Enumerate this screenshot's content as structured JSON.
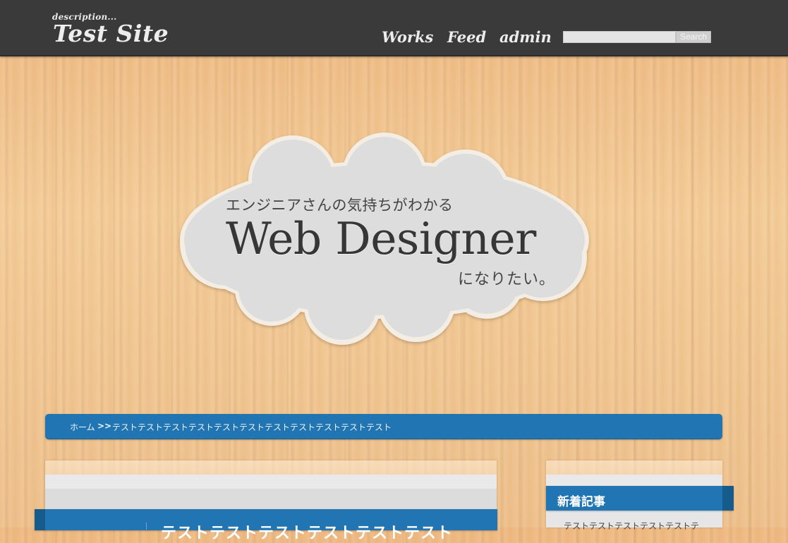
{
  "header": {
    "description": "description...",
    "site_title": "Test Site",
    "nav": [
      {
        "label": "Works"
      },
      {
        "label": "Feed"
      },
      {
        "label": "admin"
      }
    ],
    "search": {
      "value": "",
      "button_label": "Search"
    }
  },
  "hero": {
    "subtitle": "エンジニアさんの気持ちがわかる",
    "title": "Web Designer",
    "tail": "になりたい。"
  },
  "breadcrumb": {
    "home": "ホーム",
    "separator": ">>",
    "current": "テストテストテストテストテストテストテストテストテストテストテスト"
  },
  "main": {
    "post_title": "テストテストテストテストテストテスト"
  },
  "sidebar": {
    "section_title": "新着記事",
    "items": [
      {
        "label": "テストテストテストテストテストテ"
      }
    ]
  },
  "colors": {
    "header_bg": "#3a3a3a",
    "accent_blue": "#2275b3",
    "cloud": "#dcdcdc"
  }
}
